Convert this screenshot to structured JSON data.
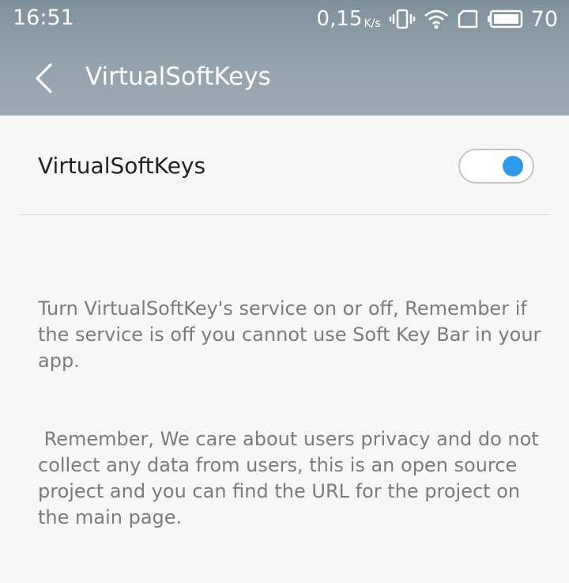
{
  "status_bar": {
    "time": "16:51",
    "net_speed": "0,15",
    "net_speed_unit": "K/s",
    "battery_level": "70",
    "icons": [
      "vibrate-icon",
      "wifi-icon",
      "sim-card-icon",
      "battery-icon"
    ]
  },
  "toolbar": {
    "back_icon": "chevron-left-icon",
    "title": "VirtualSoftKeys"
  },
  "setting": {
    "label": "VirtualSoftKeys",
    "enabled": true,
    "accent_color": "#2f9be8"
  },
  "description": {
    "line1": "Turn VirtualSoftKey's service on or off, Remember if the service is off you cannot use Soft Key Bar in your app.",
    "line2": " Remember, We care about users privacy and do not collect any data from users, this is an open source project and you can find the URL for the project on the main page."
  }
}
